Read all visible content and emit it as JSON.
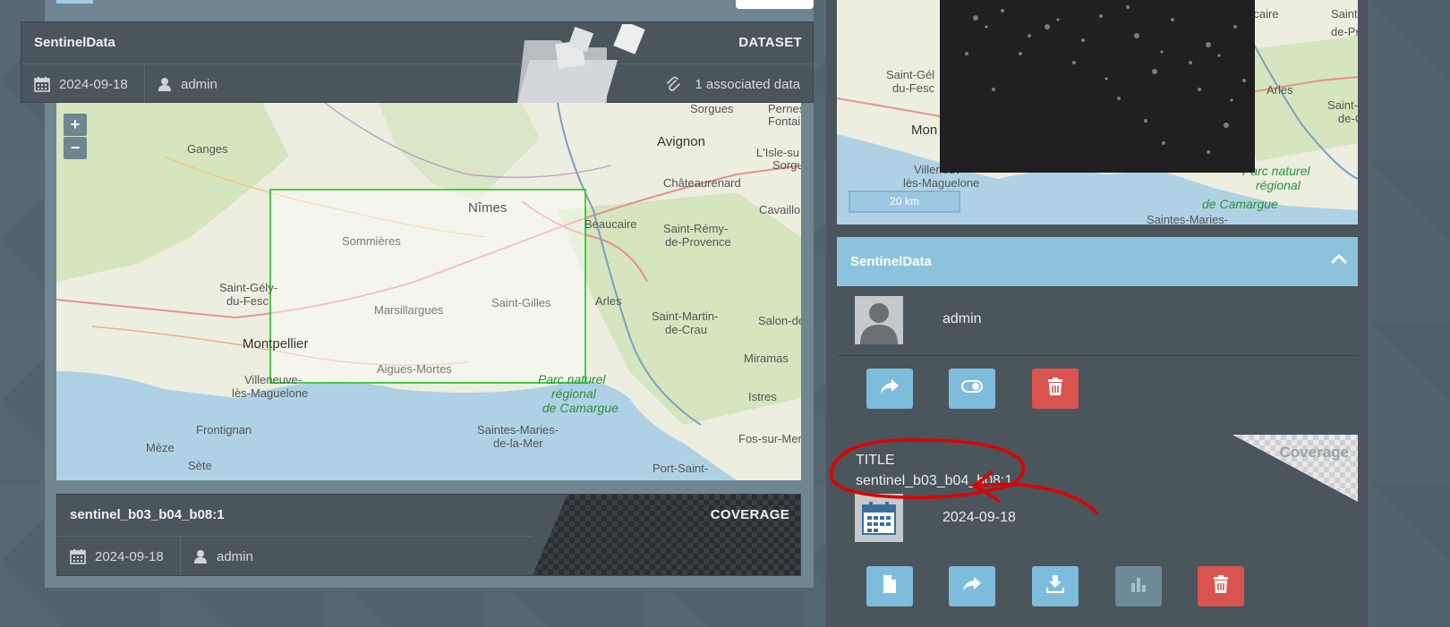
{
  "dataset": {
    "title": "SentinelData",
    "type_label": "DATASET",
    "date": "2024-09-18",
    "owner": "admin",
    "associated": "1 associated data"
  },
  "map": {
    "zoom_in": "+",
    "zoom_out": "−",
    "places": [
      "Sorgues",
      "Pernes",
      "Fontai",
      "Ganges",
      "Avignon",
      "L'Isle-su",
      "Sorgu",
      "Châteaurenard",
      "Nîmes",
      "Beaucaire",
      "Cavaillo",
      "Sommières",
      "Saint-Rémy-",
      "de-Provence",
      "Saint-Gély-",
      "du-Fesc",
      "Marsillargues",
      "Saint-Gilles",
      "Arles",
      "Saint-Martin-",
      "de-Crau",
      "Salon-de",
      "Montpellier",
      "Miramas",
      "Villeneuve-",
      "lès-Maguelone",
      "Aigues-Mortes",
      "Parc naturel",
      "régional",
      "de Camargue",
      "Istres",
      "Frontignan",
      "Saintes-Maries-",
      "de-la-Mer",
      "Fos-sur-Mer",
      "Mèze",
      "Sète",
      "Port-Saint-"
    ]
  },
  "coverage_card": {
    "title": "sentinel_b03_b04_b08:1",
    "type_label": "COVERAGE",
    "date": "2024-09-18",
    "owner": "admin"
  },
  "right_map": {
    "scale": "20 km",
    "places": [
      "Beaucaire",
      "Saint-",
      "de-Pr",
      "Saint-Gél",
      "du-Fesc",
      "Arles",
      "Saint-M",
      "de-C",
      "Mon",
      "Villeneuv",
      "lès-Maguelone",
      "Parc naturel",
      "régional",
      "de Camargue",
      "Saintes-Maries-"
    ]
  },
  "panel": {
    "header": "SentinelData",
    "owner": "admin"
  },
  "coverage_panel": {
    "corner_label": "Coverage",
    "title_key": "TITLE",
    "title_value": "sentinel_b03_b04_b08:1",
    "date": "2024-09-18"
  },
  "colors": {
    "accent_blue": "#7dbcdb",
    "danger_red": "#d9534f",
    "header_blue": "#8cc3dc",
    "bbox_green": "#22c422",
    "annotation_red": "#e00000"
  }
}
